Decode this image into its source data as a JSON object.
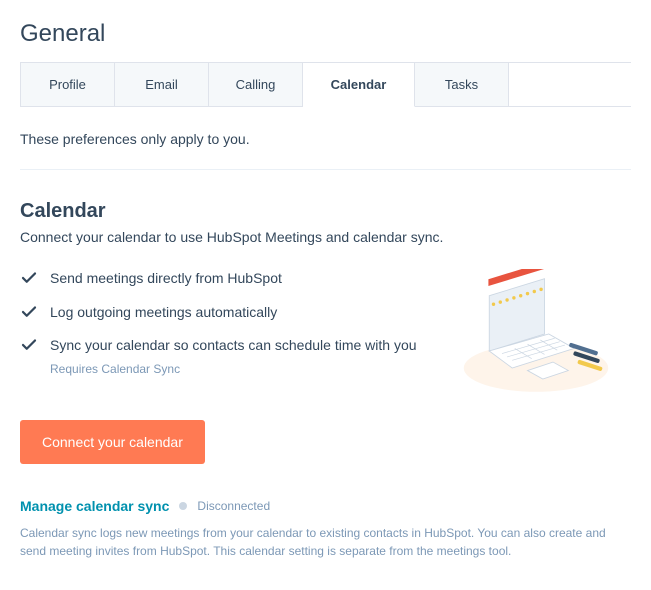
{
  "page_title": "General",
  "tabs": {
    "profile": "Profile",
    "email": "Email",
    "calling": "Calling",
    "calendar": "Calendar",
    "tasks": "Tasks"
  },
  "note": "These preferences only apply to you.",
  "section": {
    "title": "Calendar",
    "subtitle": "Connect your calendar to use HubSpot Meetings and calendar sync.",
    "bullets": {
      "b1": "Send meetings directly from HubSpot",
      "b2": "Log outgoing meetings automatically",
      "b3": "Sync your calendar so contacts can schedule time with you",
      "b3_sub": "Requires Calendar Sync"
    },
    "connect_button": "Connect your calendar"
  },
  "manage": {
    "link": "Manage calendar sync",
    "status": "Disconnected",
    "desc": "Calendar sync logs new meetings from your calendar to existing contacts in HubSpot. You can also create and send meeting invites from HubSpot. This calendar setting is separate from the meetings tool."
  }
}
